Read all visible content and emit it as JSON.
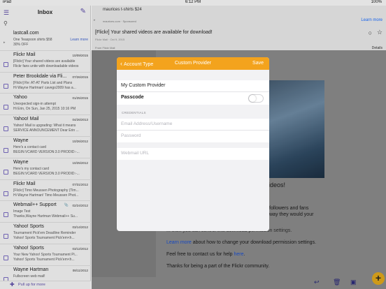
{
  "status": {
    "left": "iPad",
    "time": "6:12 PM",
    "battery": "100%"
  },
  "inbox": {
    "title": "Inbox",
    "menu_icon": "menu-icon",
    "compose_icon": "compose-icon",
    "pull_label": "Pull up for more",
    "messages": [
      {
        "from": "lastcall.com",
        "date": "",
        "line1": "One Teaspoon shirts $58",
        "line2": "30% OFF",
        "extra": "Learn more",
        "attach": ""
      },
      {
        "from": "Flickr Mail",
        "date": "10/09/2015",
        "line1": "[Flickr] Your shared videos are available",
        "line2": "Flickr fans unite with downloadable videos",
        "extra": "",
        "attach": ""
      },
      {
        "from": "Peter Brookdale via Fli...",
        "date": "07/26/2015",
        "line1": "[Flickr] Re: AT-AT Parts List and Plans",
        "line2": "Hi Wayne Hartman! cavego2009 has a...",
        "extra": "",
        "attach": ""
      },
      {
        "from": "Yahoo",
        "date": "01/25/2015",
        "line1": "Unexpected sign-in attempt",
        "line2": "Hi Erin, On Sun, Jan 25, 2015 10:16 PM",
        "extra": "",
        "attach": ""
      },
      {
        "from": "Yahoo! Mail",
        "date": "04/26/2013",
        "line1": "Yahoo! Mail is upgrading: What it means",
        "line2": "SERVICE ANNOUNCEMENT Dear Erin ...",
        "extra": "",
        "attach": ""
      },
      {
        "from": "Wayne",
        "date": "10/26/2012",
        "line1": "Here's a contact card",
        "line2": "BEGIN:VCARD VERSION:3.0 PRODID:-...",
        "extra": "",
        "attach": ""
      },
      {
        "from": "Wayne",
        "date": "10/25/2012",
        "line1": "Here's my contact card",
        "line2": "BEGIN:VCARD VERSION:3.0 PRODID:-...",
        "extra": "",
        "attach": ""
      },
      {
        "from": "Flickr Mail",
        "date": "07/31/2012",
        "line1": "[Flickr] Timo Meussen Photography (Tim...",
        "line2": "Hi Wayne Hartman! Timo Meussen Phot...",
        "extra": "",
        "attach": ""
      },
      {
        "from": "Webmail++ Support",
        "date": "02/24/2012",
        "line1": "Image Test",
        "line2": "Thanks,Wayne Hartman Webmail++ Su...",
        "extra": "",
        "attach": "📎"
      },
      {
        "from": "Yahoo! Sports",
        "date": "03/14/2012",
        "line1": "Tournament Pick'em Deadline Reminder",
        "line2": "Yahoo! Sports Tournament Pick'em<h...",
        "extra": "",
        "attach": ""
      },
      {
        "from": "Yahoo! Sports",
        "date": "03/12/2012",
        "line1": "Your New Yahoo! Sports Tournament Pi...",
        "line2": "Yahoo! Sports Tournament Pick'em<h...",
        "extra": "",
        "attach": ""
      },
      {
        "from": "Wayne Hartman",
        "date": "08/11/2012",
        "line1": "Fullscreen web mail!",
        "line2": "",
        "extra": "",
        "attach": ""
      }
    ]
  },
  "email": {
    "sender": "maurices t-shirts $24",
    "learn_more": "Learn more",
    "sub1": "maurices.com · Sponsored",
    "subject": "[Flickr] Your shared videos are available for download!",
    "meta": "Flickr Mail · Oct 9, 2015",
    "from_line": "From Flickr Mail",
    "details": "Details",
    "headline_tail": "ideos!",
    "p1a": "followers and fans",
    "p1b": "way they would your",
    "p2": "... then you can control this download permission settings.",
    "p3_link": "Learn more",
    "p3_rest": " about how to change your download permission settings.",
    "p4_pre": "Feel free to contact us for help ",
    "p4_link": "here",
    "p4_post": ".",
    "p5": "Thanks for being a part of the Flickr community."
  },
  "modal": {
    "back_label": "Account Type",
    "title": "Custom Provider",
    "save_label": "Save",
    "provider_name": "My Custom Provider",
    "passcode_label": "Passcode",
    "credentials_header": "CREDENTIALS",
    "email_placeholder": "Email Address/Username",
    "password_placeholder": "Password",
    "webmail_placeholder": "Webmail URL",
    "passcode_enabled": false
  },
  "colors": {
    "accent": "#f3a31d",
    "link": "#1a4fd0",
    "purple": "#5b4aa8"
  }
}
